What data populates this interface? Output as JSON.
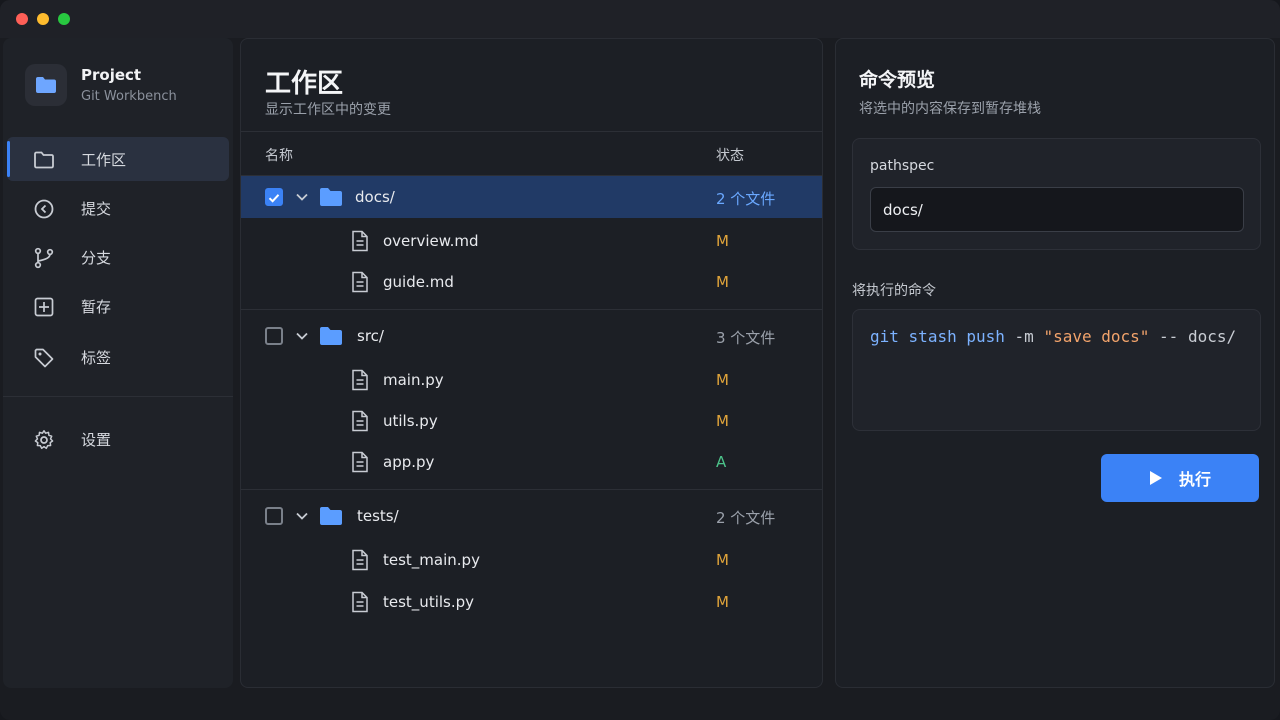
{
  "sidebar": {
    "brand": {
      "title": "Project",
      "subtitle": "Git Workbench",
      "icon": "folder-icon"
    },
    "items": [
      {
        "label": "工作区",
        "icon": "folder-icon",
        "active": true
      },
      {
        "label": "提交",
        "icon": "commit-icon",
        "active": false
      },
      {
        "label": "分支",
        "icon": "branch-icon",
        "active": false
      },
      {
        "label": "暂存",
        "icon": "stash-icon",
        "active": false
      },
      {
        "label": "标签",
        "icon": "tag-icon",
        "active": false
      }
    ],
    "settings": {
      "label": "设置",
      "icon": "gear-icon"
    }
  },
  "workspace": {
    "title": "工作区",
    "subtitle": "显示工作区中的变更",
    "columns": {
      "name": "名称",
      "status": "状态"
    },
    "groups": [
      {
        "name": "docs/",
        "count": "2 个文件",
        "checked": true,
        "selected": true,
        "files": [
          {
            "name": "overview.md",
            "status": "M"
          },
          {
            "name": "guide.md",
            "status": "M"
          }
        ]
      },
      {
        "name": "src/",
        "count": "3 个文件",
        "checked": false,
        "selected": false,
        "files": [
          {
            "name": "main.py",
            "status": "M"
          },
          {
            "name": "utils.py",
            "status": "M"
          },
          {
            "name": "app.py",
            "status": "A"
          }
        ]
      },
      {
        "name": "tests/",
        "count": "2 个文件",
        "checked": false,
        "selected": false,
        "files": [
          {
            "name": "test_main.py",
            "status": "M"
          },
          {
            "name": "test_utils.py",
            "status": "M"
          }
        ]
      }
    ]
  },
  "preview": {
    "title": "命令预览",
    "subtitle": "将选中的内容保存到暂存堆栈",
    "pathspec_label": "pathspec",
    "pathspec_value": "docs/",
    "command_label": "将执行的命令",
    "command": {
      "git": "git",
      "stash": "stash",
      "push": "push",
      "flag": "-m",
      "message": "\"save docs\"",
      "sep": "--",
      "path": "docs/"
    },
    "run_label": "执行"
  },
  "colors": {
    "accent": "#3b82f6",
    "modified": "#e0a43a",
    "added": "#4cc38a",
    "selected_row": "#213a66"
  }
}
